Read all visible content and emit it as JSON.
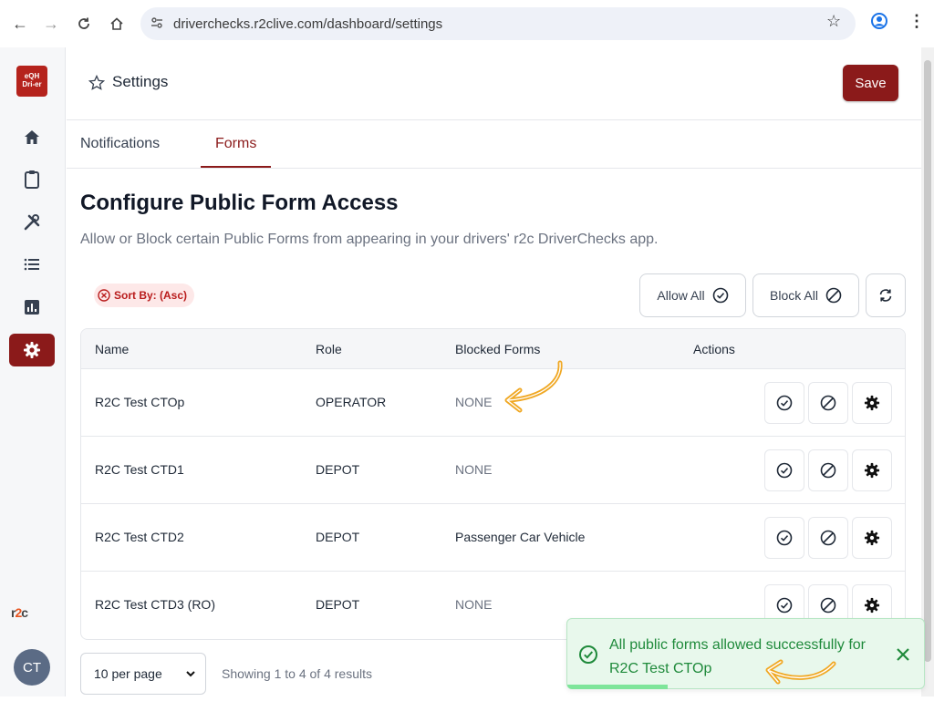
{
  "browser": {
    "url": "driverchecks.r2clive.com/dashboard/settings"
  },
  "sidebar": {
    "logo_top": "eQH",
    "logo_bottom": "Dri-er",
    "items": [
      {
        "icon": "home-icon"
      },
      {
        "icon": "clipboard-icon"
      },
      {
        "icon": "tools-icon"
      },
      {
        "icon": "list-icon"
      },
      {
        "icon": "chart-icon"
      },
      {
        "icon": "gear-icon",
        "active": true
      }
    ],
    "brand_left": "r",
    "brand_mid": "2",
    "brand_right": "c",
    "avatar_initials": "CT"
  },
  "header": {
    "title": "Settings",
    "save_label": "Save"
  },
  "tabs": [
    {
      "label": "Notifications",
      "active": false
    },
    {
      "label": "Forms",
      "active": true
    }
  ],
  "section": {
    "heading": "Configure Public Form Access",
    "description": "Allow or Block certain Public Forms from appearing in your drivers' r2c DriverChecks app."
  },
  "toolbar": {
    "sort_label": "Sort By: (Asc)",
    "allow_all_label": "Allow All",
    "block_all_label": "Block All"
  },
  "table": {
    "columns": [
      "Name",
      "Role",
      "Blocked Forms",
      "Actions"
    ],
    "rows": [
      {
        "name": "R2C Test CTOp",
        "role": "OPERATOR",
        "blocked": "NONE"
      },
      {
        "name": "R2C Test CTD1",
        "role": "DEPOT",
        "blocked": "NONE"
      },
      {
        "name": "R2C Test CTD2",
        "role": "DEPOT",
        "blocked": "Passenger Car Vehicle"
      },
      {
        "name": "R2C Test CTD3 (RO)",
        "role": "DEPOT",
        "blocked": "NONE"
      }
    ]
  },
  "pagination": {
    "per_page": "10 per page",
    "showing": "Showing 1 to 4 of 4 results"
  },
  "toast": {
    "message": "All public forms allowed successfully for R2C Test CTOp"
  },
  "colors": {
    "brand": "#8b1a1a",
    "success": "#1f8a3b",
    "annotation": "#f0a824"
  }
}
